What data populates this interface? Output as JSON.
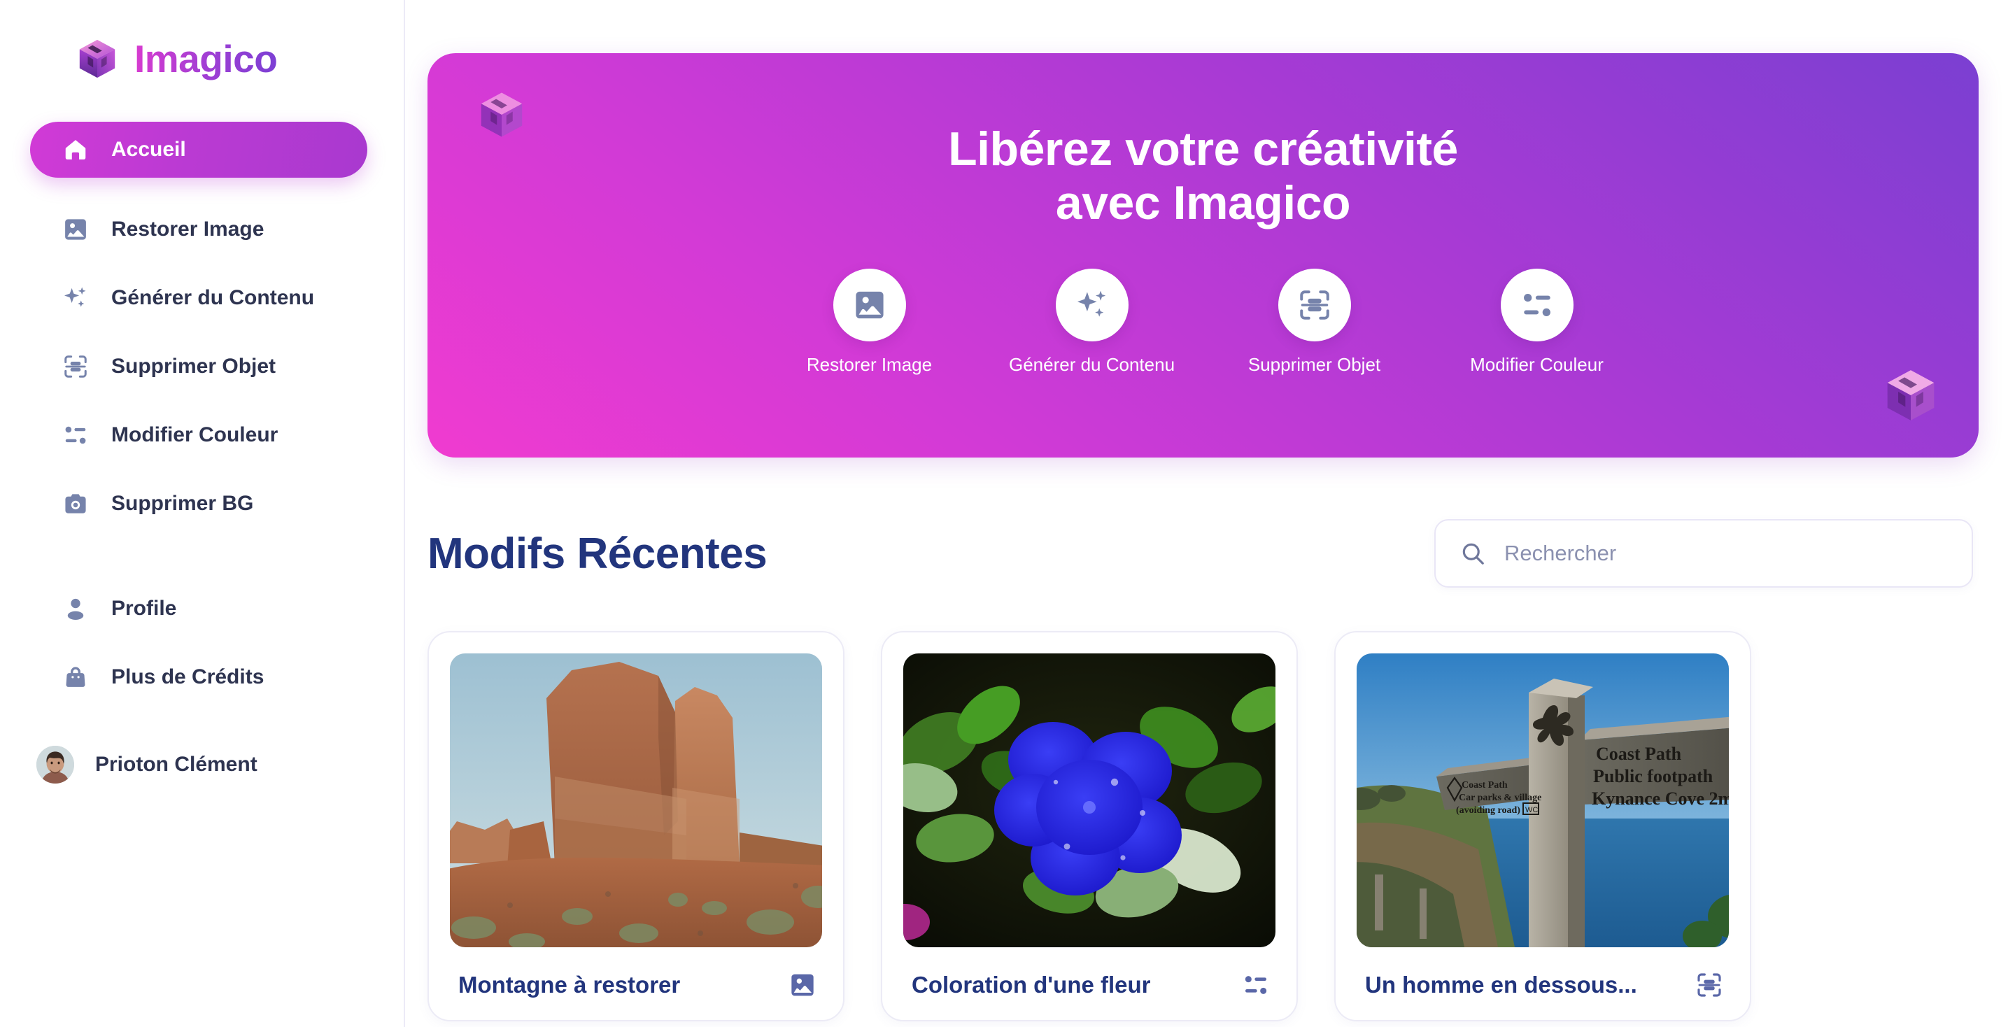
{
  "brand": {
    "name": "Imagico"
  },
  "sidebar": {
    "items": [
      {
        "label": "Accueil",
        "icon": "home-icon",
        "active": true
      },
      {
        "label": "Restorer Image",
        "icon": "image-icon",
        "active": false
      },
      {
        "label": "Générer du Contenu",
        "icon": "sparkles-icon",
        "active": false
      },
      {
        "label": "Supprimer Objet",
        "icon": "scan-object-icon",
        "active": false
      },
      {
        "label": "Modifier Couleur",
        "icon": "color-filter-icon",
        "active": false
      },
      {
        "label": "Supprimer BG",
        "icon": "camera-icon",
        "active": false
      }
    ],
    "secondary": [
      {
        "label": "Profile",
        "icon": "user-icon"
      },
      {
        "label": "Plus de Crédits",
        "icon": "shopping-bag-icon"
      }
    ],
    "user": {
      "name": "Prioton Clément",
      "avatar": "user-photo-avatar"
    }
  },
  "hero": {
    "title_line1": "Libérez votre créativité",
    "title_line2": "avec Imagico",
    "decor_logo": "imagico-cube-logo",
    "actions": [
      {
        "label": "Restorer Image",
        "icon": "image-icon"
      },
      {
        "label": "Générer du Contenu",
        "icon": "sparkles-icon"
      },
      {
        "label": "Supprimer Objet",
        "icon": "scan-object-icon"
      },
      {
        "label": "Modifier Couleur",
        "icon": "color-filter-icon"
      }
    ]
  },
  "recent": {
    "heading": "Modifs Récentes",
    "search": {
      "placeholder": "Rechercher",
      "value": "",
      "icon": "search-icon"
    },
    "cards": [
      {
        "title": "Montagne à restorer",
        "badge_icon": "image-icon",
        "thumb": "desert-rock-formation-photo"
      },
      {
        "title": "Coloration d'une fleur",
        "badge_icon": "color-filter-icon",
        "thumb": "blue-flower-photo"
      },
      {
        "title": "Un homme en dessous...",
        "badge_icon": "scan-object-icon",
        "thumb": "coastal-signpost-photo"
      }
    ]
  },
  "colors": {
    "brand_pink": "#d93bd0",
    "brand_purple": "#7b3fd4",
    "heading_navy": "#22357d",
    "icon_slate": "#7683ab",
    "text_dark": "#2e3450"
  }
}
